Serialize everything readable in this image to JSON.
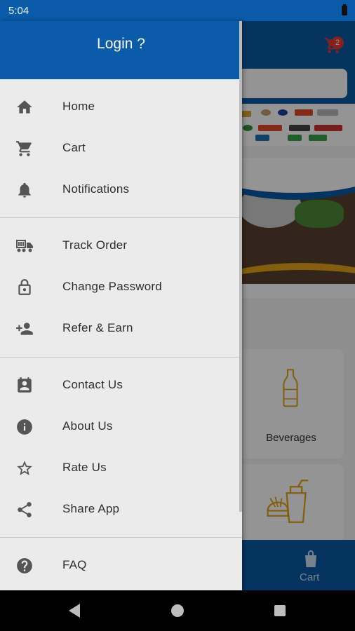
{
  "status_bar": {
    "time": "5:04"
  },
  "background": {
    "cart_badge": "2",
    "categories": [
      "Beverages"
    ],
    "bottom_nav_cart_label": "Cart"
  },
  "drawer": {
    "header_title": "Login ?",
    "groups": [
      [
        {
          "label": "Home",
          "icon": "home-icon"
        },
        {
          "label": "Cart",
          "icon": "cart-icon"
        },
        {
          "label": "Notifications",
          "icon": "bell-icon"
        }
      ],
      [
        {
          "label": "Track Order",
          "icon": "truck-icon"
        },
        {
          "label": "Change Password",
          "icon": "lock-icon"
        },
        {
          "label": "Refer & Earn",
          "icon": "person-add-icon"
        }
      ],
      [
        {
          "label": "Contact Us",
          "icon": "contact-card-icon"
        },
        {
          "label": "About Us",
          "icon": "info-icon"
        },
        {
          "label": "Rate Us",
          "icon": "star-icon"
        },
        {
          "label": "Share App",
          "icon": "share-icon"
        }
      ],
      [
        {
          "label": "FAQ",
          "icon": "help-icon"
        }
      ]
    ]
  },
  "colors": {
    "brand_blue": "#0a5ba8",
    "drawer_bg": "#ebebeb",
    "icon_gray": "#555555",
    "accent_gold": "#e2a21b",
    "badge_red": "#e53935"
  }
}
